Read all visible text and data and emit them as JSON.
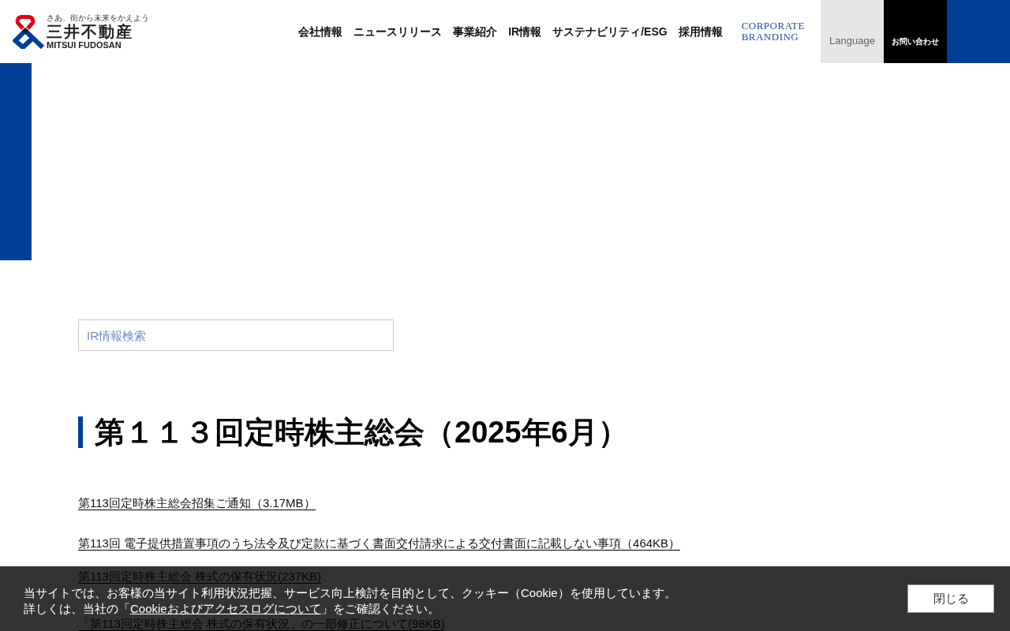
{
  "header": {
    "logo": {
      "tagline": "さあ、街から未来をかえよう",
      "name": "三井不動産",
      "name_latin": "MITSUI FUDOSAN"
    },
    "nav": [
      "会社情報",
      "ニュースリリース",
      "事業紹介",
      "IR情報",
      "サステナビリティ/ESG",
      "採用情報"
    ],
    "branding": {
      "line_1": "CORPORATE",
      "line_2": "BRANDING"
    },
    "language_button": "Language",
    "contact_button": "お問い合わせ"
  },
  "search": {
    "placeholder": "IR情報検索"
  },
  "heading": "第１１３回定時株主総会（2025年6月）",
  "documents": [
    "第113回定時株主総会招集ご通知（3.17MB）",
    "第113回 電子提供措置事項のうち法令及び定款に基づく書面交付請求による交付書面に記載しない事項（464KB）",
    "第113回定時株主総会 株式の保有状況(237KB)",
    "「第113回定時株主総会 株式の保有状況」の一部修正について(98KB)"
  ],
  "cookie_banner": {
    "message": "当サイトでは、お客様の当サイト利用状況把握、サービス向上検討を目的として、クッキー（Cookie）を使用しています。",
    "detail_before": "詳しくは、当社の「",
    "link": "Cookieおよびアクセスログについて",
    "detail_after": "」をご確認ください。",
    "close_button": "閉じる"
  }
}
